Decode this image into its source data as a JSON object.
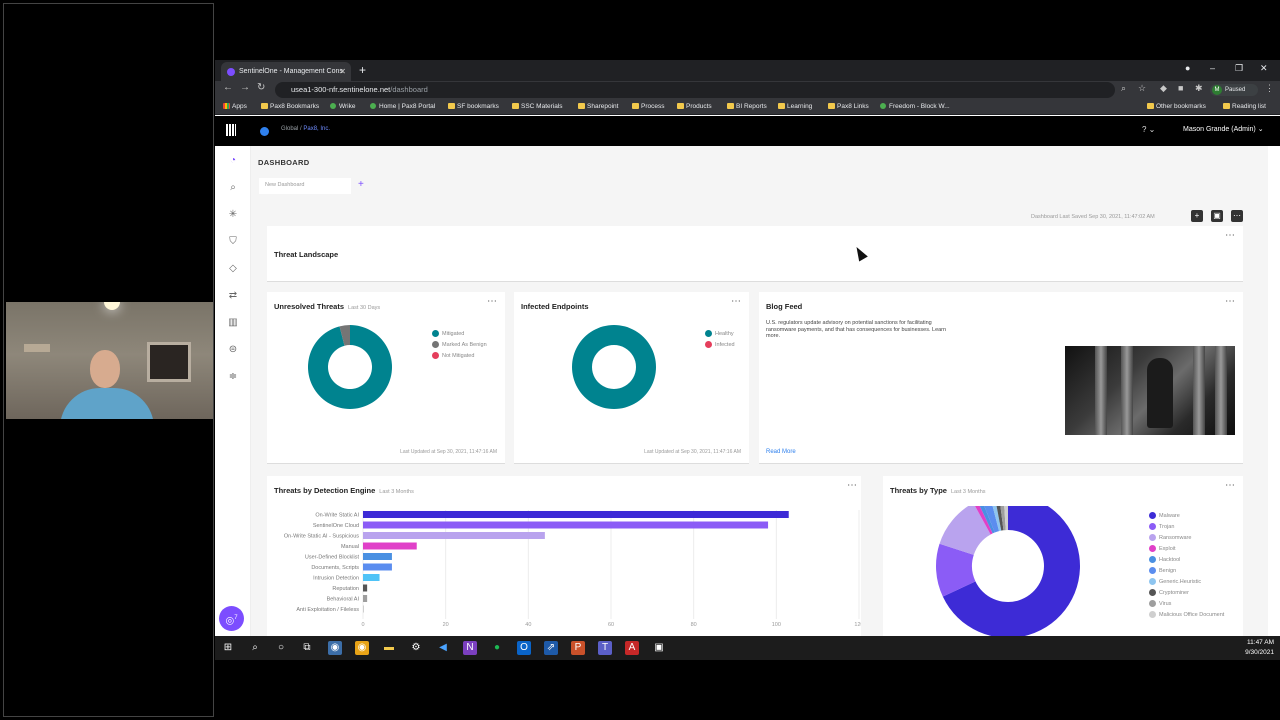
{
  "browser": {
    "tab_title": "SentinelOne - Management Cons",
    "url_host": "usea1-300-nfr.sentinelone.net",
    "url_path": "/dashboard",
    "profile_status": "Paused",
    "profile_initial": "M",
    "bookmarks": [
      "Apps",
      "Pax8 Bookmarks",
      "Wrike",
      "Home | Pax8 Portal",
      "SF bookmarks",
      "SSC Materials",
      "Sharepoint",
      "Process",
      "Products",
      "BI Reports",
      "Learning",
      "Pax8 Links",
      "Freedom - Block W...",
      "Other bookmarks",
      "Reading list"
    ]
  },
  "app": {
    "scope_global": "Global",
    "scope_separator": "/",
    "scope_account": "Pax8, Inc.",
    "help": "?",
    "user": "Mason Grande (Admin)",
    "page_title": "DASHBOARD",
    "dashboard_tab": "New Dashboard",
    "add_tab": "+",
    "saved_text": "Dashboard Last Saved Sep 30, 2021, 11:47:02 AM",
    "badge": "7"
  },
  "cards": {
    "threat_landscape": {
      "title": "Threat Landscape"
    },
    "unresolved": {
      "title": "Unresolved Threats",
      "subtitle": "Last 30 Days",
      "legend": [
        "Mitigated",
        "Marked As Benign",
        "Not Mitigated"
      ],
      "updated": "Last Updated at Sep 30, 2021, 11:47:16 AM"
    },
    "infected": {
      "title": "Infected Endpoints",
      "legend": [
        "Healthy",
        "Infected"
      ],
      "updated": "Last Updated at Sep 30, 2021, 11:47:16 AM"
    },
    "blog": {
      "title": "Blog Feed",
      "text": "U.S. regulators update advisory on potential sanctions for facilitating ransomware payments, and that has consequences for businesses. Learn more.",
      "read_more": "Read More"
    },
    "by_engine": {
      "title": "Threats by Detection Engine",
      "subtitle": "Last 3 Months"
    },
    "by_type": {
      "title": "Threats by Type",
      "subtitle": "Last 3 Months",
      "legend": [
        "Malware",
        "Trojan",
        "Ransomware",
        "Exploit",
        "Hacktool",
        "Benign",
        "Generic.Heuristic",
        "Cryptominer",
        "Virus",
        "Malicious Office Document"
      ]
    }
  },
  "colors": {
    "teal": "#00838f",
    "grey": "#757575",
    "red": "#e53e5c",
    "purple": "#7c4dff",
    "indigo": "#3d2bd6"
  },
  "chart_data": [
    {
      "type": "pie",
      "labels": [
        "Mitigated",
        "Marked As Benign",
        "Not Mitigated"
      ],
      "values": [
        96,
        4,
        0
      ]
    },
    {
      "type": "pie",
      "labels": [
        "Healthy",
        "Infected"
      ],
      "values": [
        100,
        0
      ]
    },
    {
      "type": "bar",
      "categories": [
        "On-Write Static AI",
        "SentinelOne Cloud",
        "On-Write Static AI - Suspicious",
        "Manual",
        "User-Defined Blocklist",
        "Documents, Scripts",
        "Intrusion Detection",
        "Reputation",
        "Behavioral AI",
        "Anti Exploitation / Fileless"
      ],
      "values": [
        103,
        98,
        44,
        13,
        7,
        7,
        4,
        1,
        1,
        0
      ],
      "xlim": [
        0,
        120
      ],
      "xticks": [
        "0",
        "20",
        "40",
        "60",
        "80",
        "100",
        "120"
      ]
    },
    {
      "type": "pie",
      "labels": [
        "Malware",
        "Trojan",
        "Ransomware",
        "Exploit",
        "Hacktool",
        "Benign",
        "Generic.Heuristic",
        "Cryptominer",
        "Virus",
        "Malicious Office Document"
      ],
      "values": [
        68,
        12,
        12,
        1,
        1,
        2,
        1,
        1,
        1,
        1
      ]
    }
  ],
  "taskbar": {
    "time": "11:47 AM",
    "date": "9/30/2021"
  }
}
